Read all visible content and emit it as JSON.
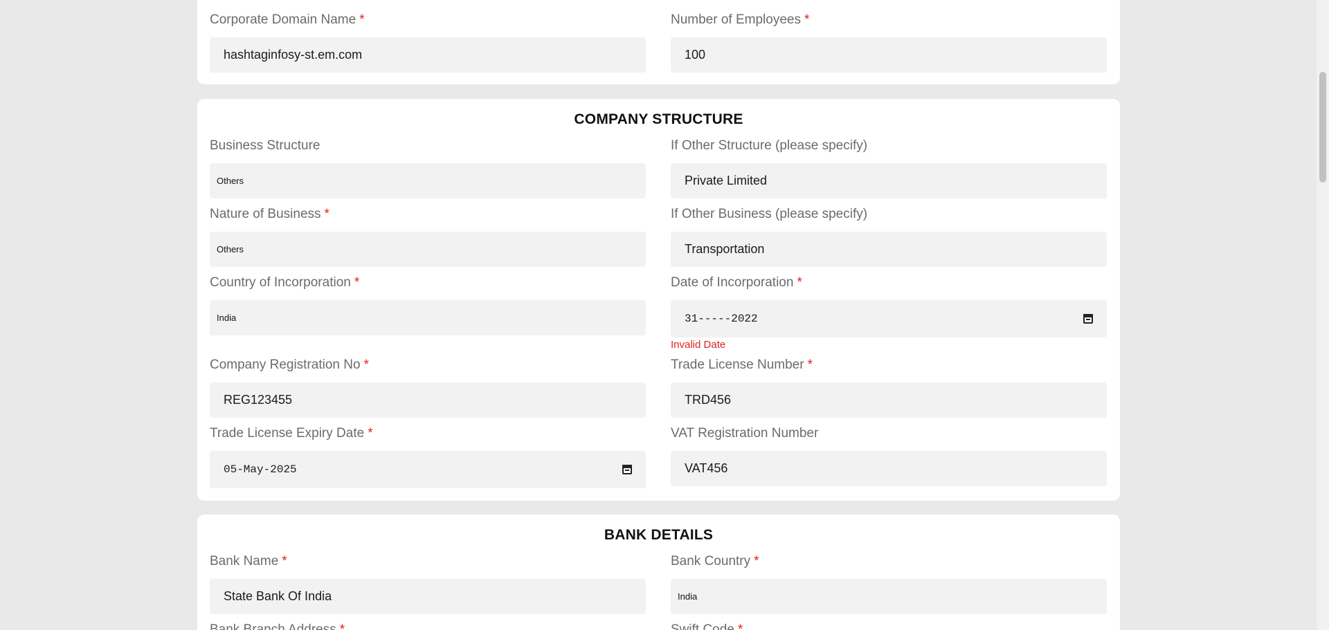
{
  "top_section": {
    "corporate_domain_label": "Corporate Domain Name",
    "corporate_domain_value": "hashtaginfosy-st.em.com",
    "employees_label": "Number of Employees",
    "employees_value": "100",
    "required_mark": "*"
  },
  "company_structure": {
    "title": "COMPANY STRUCTURE",
    "business_structure_label": "Business Structure",
    "business_structure_value": "Others",
    "other_structure_label": "If Other Structure (please specify)",
    "other_structure_value": "Private Limited",
    "nature_label": "Nature of Business",
    "nature_value": "Others",
    "other_business_label": "If Other Business (please specify)",
    "other_business_value": "Transportation",
    "country_label": "Country of Incorporation",
    "country_value": "India",
    "date_label": "Date of Incorporation",
    "date_value": "31-----2022",
    "date_error": "Invalid Date",
    "reg_no_label": "Company Registration No",
    "reg_no_value": "REG123455",
    "trade_license_label": "Trade License Number",
    "trade_license_value": "TRD456",
    "expiry_label": "Trade License Expiry Date",
    "expiry_value": "05-May-2025",
    "vat_label": "VAT Registration Number",
    "vat_value": "VAT456",
    "required_mark": "*"
  },
  "bank_details": {
    "title": "BANK DETAILS",
    "bank_name_label": "Bank Name",
    "bank_name_value": "State Bank Of India",
    "bank_country_label": "Bank Country",
    "bank_country_value": "India",
    "branch_address_label": "Bank Branch Address",
    "swift_label": "Swift Code",
    "required_mark": "*"
  },
  "colors": {
    "required": "#e0201f",
    "page_background": "#e9e9e9",
    "input_background": "#f2f2f2"
  }
}
